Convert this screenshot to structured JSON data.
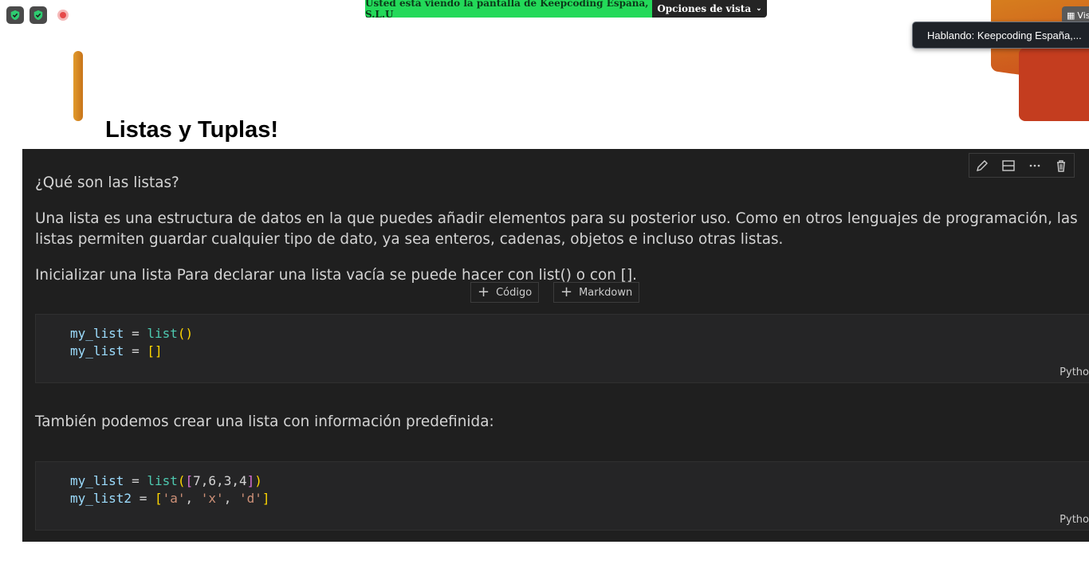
{
  "zoom": {
    "share_banner": "Usted está viendo la pantalla de Keepcoding España, S.L.U",
    "view_options": "Opciones de vista",
    "speaking": "Hablando: Keepcoding España,...",
    "view_tab_label": "Vis"
  },
  "slide": {
    "title": "Listas y Tuplas!"
  },
  "notebook": {
    "md_heading": "¿Qué son las listas?",
    "md_paragraph": "Una lista es una estructura de datos en la que puedes añadir elementos para su posterior uso. Como en otros lenguajes de programación, las listas permiten guardar cualquier tipo de dato, ya sea enteros, cadenas, objetos e incluso otras listas.",
    "md_init": "Inicializar una lista Para declarar una lista vacía se puede hacer con list() o con [].",
    "add_code": "Código",
    "add_markdown": "Markdown",
    "md_predefined": "También podemos crear una lista con información predefinida:",
    "cell_language": "Pytho",
    "code_cell_1": {
      "l1_var": "my_list",
      "l1_op": " = ",
      "l1_fn": "list",
      "l1_open": "(",
      "l1_close": ")",
      "l2_var": "my_list",
      "l2_op": " = ",
      "l2_lit": "[]"
    },
    "code_cell_2": {
      "l1_var": "my_list",
      "l1_op": " = ",
      "l1_fn": "list",
      "l1_open": "(",
      "l1_lb": "[",
      "l1_vals": "7,6,3,4",
      "l1_rb": "]",
      "l1_close": ")",
      "l2_var": "my_list2",
      "l2_op": " = ",
      "l2_lb": "[",
      "s1": "'a'",
      "c1": ", ",
      "s2": "'x'",
      "c2": ", ",
      "s3": "'d'",
      "l2_rb": "]"
    }
  }
}
